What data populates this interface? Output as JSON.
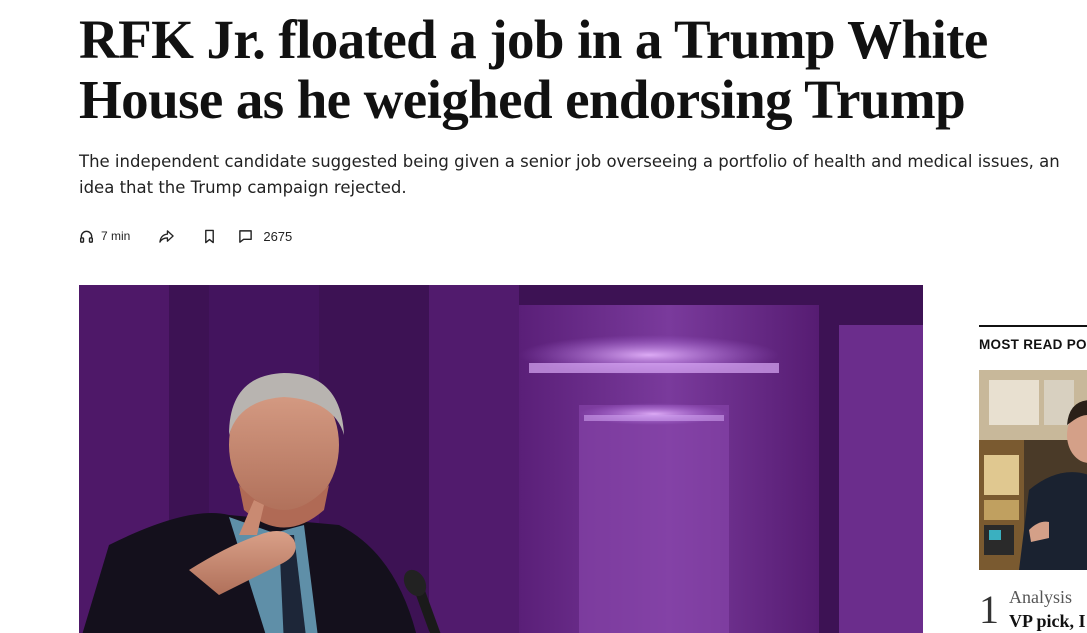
{
  "article": {
    "headline": "RFK Jr. floated a job in a Trump White House as he weighed endorsing Trump",
    "dek": "The independent candidate suggested being given a senior job overseeing a portfolio of health and medical issues, an idea that the Trump campaign rejected.",
    "toolbar": {
      "listen_icon": "headphones-icon",
      "listen_label": "7 min",
      "share_icon": "share-icon",
      "save_icon": "bookmark-icon",
      "comments_icon": "comment-icon",
      "comments_count": "2675"
    }
  },
  "sidebar": {
    "label": "MOST READ PO",
    "most_read": [
      {
        "rank": "1",
        "kicker": "Analysis",
        "title": "VP pick, I"
      }
    ]
  },
  "colors": {
    "hero_purple": "#6a2a8a",
    "hero_dark": "#2a0c3a",
    "text": "#111111",
    "rule": "#111111"
  }
}
